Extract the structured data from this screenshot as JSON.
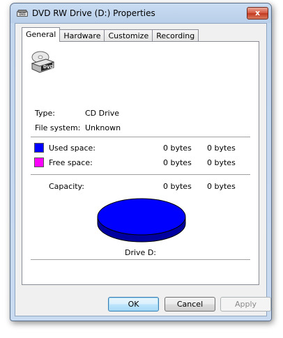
{
  "window": {
    "title": "DVD RW Drive (D:) Properties",
    "close_glyph": "x"
  },
  "tabs": [
    {
      "label": "General",
      "active": true
    },
    {
      "label": "Hardware",
      "active": false
    },
    {
      "label": "Customize",
      "active": false
    },
    {
      "label": "Recording",
      "active": false
    }
  ],
  "drive_icon": {
    "text": "DVD",
    "icon": "dvd-drive-icon"
  },
  "info": {
    "type_label": "Type:",
    "type_value": "CD Drive",
    "fs_label": "File system:",
    "fs_value": "Unknown"
  },
  "space": {
    "used": {
      "label": "Used space:",
      "bytes": "0 bytes",
      "size": "0 bytes",
      "color": "#0000ff"
    },
    "free": {
      "label": "Free space:",
      "bytes": "0 bytes",
      "size": "0 bytes",
      "color": "#ff00ff"
    },
    "capacity": {
      "label": "Capacity:",
      "bytes": "0 bytes",
      "size": "0 bytes"
    }
  },
  "pie": {
    "used_fraction": 1.0,
    "top_color": "#0000ff",
    "side_color": "#0000a0"
  },
  "drive_label": "Drive D:",
  "buttons": {
    "ok": "OK",
    "cancel": "Cancel",
    "apply": "Apply"
  }
}
